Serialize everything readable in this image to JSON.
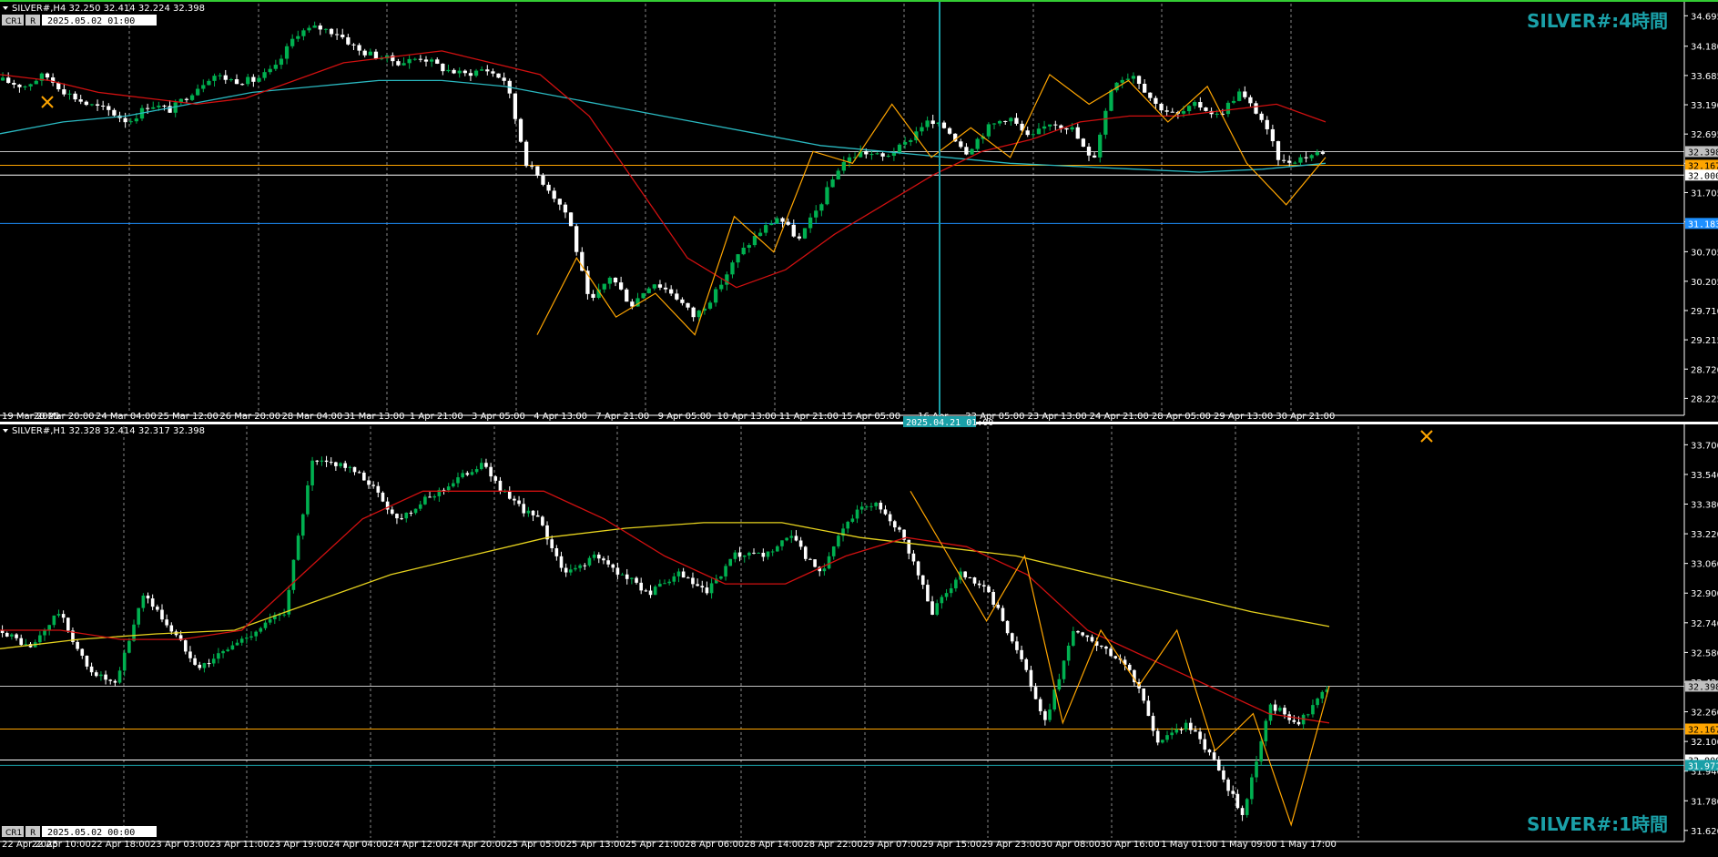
{
  "chart_data": [
    {
      "type": "candlestick",
      "pane": "top",
      "title": "SILVER#,H4  32.250 32.414 32.224 32.398",
      "label": "SILVER#:4時間",
      "badge": "CR1",
      "badge2": "R",
      "time_box": "2025.05.02 01:00",
      "ylim": [
        28.0,
        34.9
      ],
      "yticks": [
        "34.695",
        "34.180",
        "33.685",
        "33.190",
        "32.695",
        "32.200",
        "31.705",
        "31.210",
        "30.705",
        "30.205",
        "29.710",
        "29.215",
        "28.720",
        "28.225"
      ],
      "xticks": [
        "19 Mar 2025",
        "20 Mar 20:00",
        "24 Mar 04:00",
        "25 Mar 12:00",
        "26 Mar 20:00",
        "28 Mar 04:00",
        "31 Mar 13:00",
        "1 Apr 21:00",
        "3 Apr 05:00",
        "4 Apr 13:00",
        "7 Apr 21:00",
        "9 Apr 05:00",
        "10 Apr 13:00",
        "11 Apr 21:00",
        "15 Apr 05:00",
        "16 Apr",
        "22 Apr 05:00",
        "23 Apr 13:00",
        "24 Apr 21:00",
        "28 Apr 05:00",
        "29 Apr 13:00",
        "30 Apr 21:00"
      ],
      "cursor_label": "2025.04.21 01:00",
      "hlines": [
        {
          "value": 32.398,
          "color": "#c0c0c0",
          "label": "32.398"
        },
        {
          "value": 32.167,
          "color": "#ffa500",
          "label": "32.167"
        },
        {
          "value": 32.0,
          "color": "#ffffff",
          "label": "32.000"
        },
        {
          "value": 31.183,
          "color": "#1e90ff",
          "label": "31.183"
        }
      ],
      "close_path": [
        33.6,
        33.5,
        33.7,
        33.4,
        33.2,
        33.1,
        32.9,
        33.2,
        33.1,
        33.4,
        33.7,
        33.6,
        33.6,
        33.8,
        34.4,
        34.5,
        34.4,
        34.1,
        34.0,
        33.9,
        34.0,
        33.8,
        33.7,
        33.8,
        33.6,
        32.2,
        31.8,
        31.3,
        29.8,
        30.3,
        29.8,
        30.2,
        30.0,
        29.6,
        30.0,
        30.6,
        31.0,
        31.3,
        30.9,
        31.5,
        32.2,
        32.4,
        32.3,
        32.5,
        32.9,
        32.8,
        32.4,
        32.8,
        33.0,
        32.6,
        32.9,
        32.8,
        32.2,
        33.6,
        33.7,
        33.2,
        33.0,
        33.2,
        33.0,
        33.4,
        33.0,
        32.2,
        32.3,
        32.398
      ],
      "ma_red": [
        33.7,
        33.6,
        33.4,
        33.3,
        33.2,
        33.3,
        33.6,
        33.9,
        34.0,
        34.1,
        33.9,
        33.7,
        33.0,
        31.8,
        30.6,
        30.1,
        30.4,
        31.0,
        31.5,
        32.0,
        32.4,
        32.6,
        32.9,
        33.0,
        33.0,
        33.1,
        33.2,
        32.9
      ],
      "ma_cyan": [
        32.7,
        32.9,
        33.0,
        33.2,
        33.4,
        33.5,
        33.6,
        33.6,
        33.5,
        33.3,
        33.1,
        32.9,
        32.7,
        32.5,
        32.4,
        32.3,
        32.2,
        32.15,
        32.1,
        32.05,
        32.1,
        32.2
      ],
      "zigzag": [
        29.3,
        30.6,
        29.6,
        30.0,
        29.3,
        31.3,
        30.7,
        32.4,
        32.2,
        33.2,
        32.3,
        32.8,
        32.3,
        33.7,
        33.2,
        33.6,
        32.9,
        33.5,
        32.2,
        31.5,
        32.3
      ]
    },
    {
      "type": "candlestick",
      "pane": "bottom",
      "title": "SILVER#,H1  32.328 32.414 32.317 32.398",
      "label": "SILVER#:1時間",
      "badge": "CR1",
      "badge2": "R",
      "time_box": "2025.05.02 00:00",
      "ylim": [
        31.58,
        33.8
      ],
      "yticks": [
        "33.700",
        "33.540",
        "33.380",
        "33.220",
        "33.060",
        "32.900",
        "32.740",
        "32.580",
        "32.420",
        "32.260",
        "32.100",
        "31.940",
        "31.780",
        "31.620"
      ],
      "xticks": [
        "22 Apr 2025",
        "22 Apr 10:00",
        "22 Apr 18:00",
        "23 Apr 03:00",
        "23 Apr 11:00",
        "23 Apr 19:00",
        "24 Apr 04:00",
        "24 Apr 12:00",
        "24 Apr 20:00",
        "25 Apr 05:00",
        "25 Apr 13:00",
        "25 Apr 21:00",
        "28 Apr 06:00",
        "28 Apr 14:00",
        "28 Apr 22:00",
        "29 Apr 07:00",
        "29 Apr 15:00",
        "29 Apr 23:00",
        "30 Apr 08:00",
        "30 Apr 16:00",
        "1 May 01:00",
        "1 May 09:00",
        "1 May 17:00"
      ],
      "hlines": [
        {
          "value": 32.398,
          "color": "#c0c0c0",
          "label": "32.398"
        },
        {
          "value": 32.167,
          "color": "#ffa500",
          "label": "32.167"
        },
        {
          "value": 32.0,
          "color": "#ffffff",
          "label": "32.000"
        },
        {
          "value": 31.971,
          "color": "#1aa0a8",
          "label": "31.971"
        }
      ],
      "close_path": [
        32.7,
        32.6,
        32.8,
        32.5,
        32.4,
        32.9,
        32.7,
        32.5,
        32.6,
        32.7,
        32.8,
        33.6,
        33.6,
        33.5,
        33.3,
        33.4,
        33.5,
        33.6,
        33.4,
        33.3,
        33.0,
        33.1,
        33.0,
        32.9,
        33.0,
        32.9,
        33.1,
        33.1,
        33.2,
        33.0,
        33.3,
        33.4,
        33.2,
        32.8,
        33.0,
        32.9,
        32.6,
        32.2,
        32.7,
        32.6,
        32.5,
        32.1,
        32.2,
        32.0,
        31.7,
        32.3,
        32.2,
        32.398
      ],
      "ma_red": [
        32.7,
        32.7,
        32.65,
        32.65,
        32.7,
        33.0,
        33.3,
        33.45,
        33.45,
        33.45,
        33.3,
        33.1,
        32.95,
        32.95,
        33.1,
        33.2,
        33.15,
        33.0,
        32.7,
        32.55,
        32.4,
        32.25,
        32.2
      ],
      "ma_yellow": [
        32.6,
        32.65,
        32.68,
        32.7,
        32.85,
        33.0,
        33.1,
        33.2,
        33.25,
        33.28,
        33.28,
        33.2,
        33.15,
        33.1,
        33.0,
        32.9,
        32.8,
        32.72
      ],
      "zigzag": [
        33.45,
        33.1,
        32.75,
        33.1,
        32.2,
        32.7,
        32.4,
        32.7,
        32.05,
        32.25,
        31.65,
        32.398
      ]
    }
  ],
  "colors": {
    "bull": "#00b050",
    "bear": "#ffffff",
    "grid": "#c0c0c0",
    "ma_red": "#d01010",
    "ma_cyan": "#2ab8c0",
    "ma_yellow": "#e6d21e",
    "zigzag": "#ffa500",
    "cursor": "#1aa0a8",
    "top_border": "#33cc33",
    "big_label": "#1aa0a8"
  },
  "icons": {
    "crosshair": "crossed-tools-icon"
  }
}
